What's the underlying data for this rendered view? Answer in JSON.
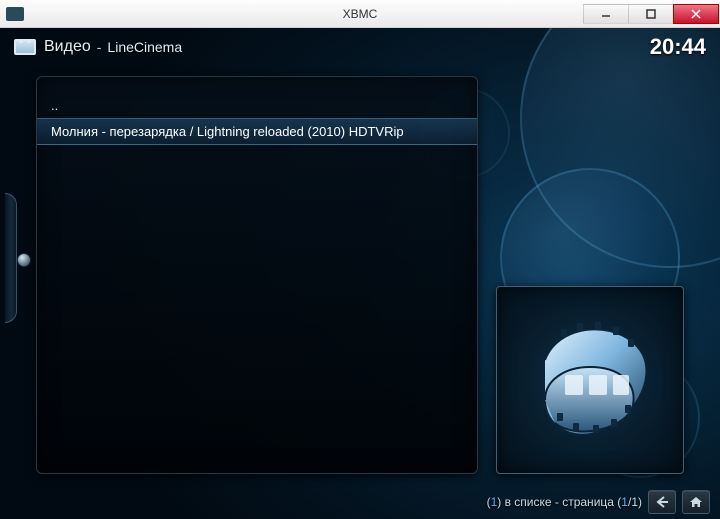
{
  "window": {
    "title": "XBMC",
    "app_icon_text": "XBMC"
  },
  "header": {
    "section": "Видео",
    "separator": "-",
    "source": "LineCinema",
    "clock": "20:44"
  },
  "list": {
    "items": [
      {
        "label": ".."
      },
      {
        "label": "Молния - перезарядка / Lightning reloaded (2010) HDTVRip"
      }
    ],
    "selected_index": 1
  },
  "thumbnail": {
    "icon": "film-reel-icon"
  },
  "footer": {
    "count": "1",
    "count_suffix": " в списке - страница ",
    "page_current": "1",
    "page_sep": "/",
    "page_total": "1",
    "open_paren": "(",
    "close_paren": ")"
  },
  "icons": {
    "back": "←",
    "home": "home"
  }
}
